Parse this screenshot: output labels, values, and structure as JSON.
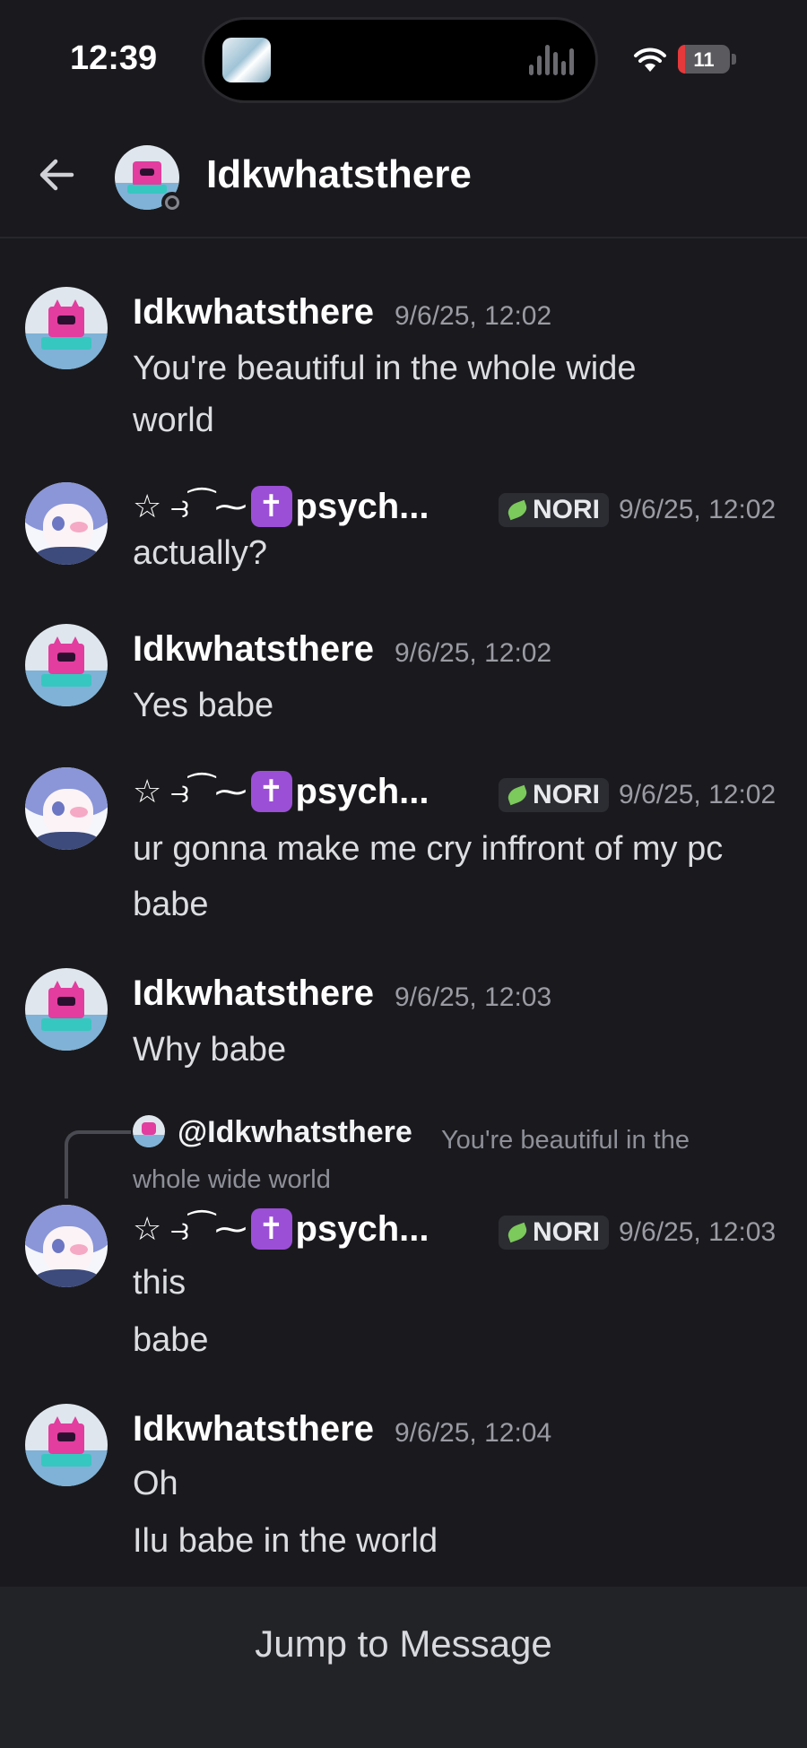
{
  "status_bar": {
    "time": "12:39",
    "battery_label": "11",
    "battery_level": 0.11,
    "icons": [
      "now-playing-art",
      "audio-waveform-icon",
      "wifi-icon",
      "battery-charging-icon"
    ]
  },
  "header": {
    "back_icon": "arrow-left-icon",
    "title": "Idkwhatsthere",
    "presence": "offline"
  },
  "colors": {
    "background": "#1a1a1e",
    "role_tag_bg": "#2c2d33",
    "cross_badge": "#9b4fd6",
    "leaf": "#7cc95c",
    "timestamp": "#9a9ba3"
  },
  "messages": [
    {
      "author": "Idkwhatsthere",
      "timestamp": "9/6/25, 12:02",
      "lines": [
        "You're beautiful in the whole wide",
        "world"
      ]
    },
    {
      "author_deco": "☆ ⥽⁀⁓",
      "author_cross": "✝",
      "author_name": "psych...",
      "tag": "NORI",
      "timestamp": "9/6/25, 12:02",
      "lines": [
        "actually?"
      ]
    },
    {
      "author": "Idkwhatsthere",
      "timestamp": "9/6/25, 12:02",
      "lines": [
        "Yes babe"
      ]
    },
    {
      "author_deco": "☆ ⥽⁀⁓",
      "author_cross": "✝",
      "author_name": "psych...",
      "tag": "NORI",
      "timestamp": "9/6/25, 12:02",
      "lines": [
        "ur gonna make me cry inffront of my pc",
        "babe"
      ]
    },
    {
      "author": "Idkwhatsthere",
      "timestamp": "9/6/25, 12:03",
      "lines": [
        "Why babe"
      ]
    },
    {
      "reply_to": {
        "mention": "@Idkwhatsthere",
        "snippet": "You're beautiful in the whole wide world"
      },
      "author_deco": "☆ ⥽⁀⁓",
      "author_cross": "✝",
      "author_name": "psych...",
      "tag": "NORI",
      "timestamp": "9/6/25, 12:03",
      "lines": [
        "this",
        "babe"
      ]
    },
    {
      "author": "Idkwhatsthere",
      "timestamp": "9/6/25, 12:04",
      "lines": [
        "Oh",
        "Ilu babe in the world"
      ]
    }
  ],
  "jump_button": "Jump to Message"
}
